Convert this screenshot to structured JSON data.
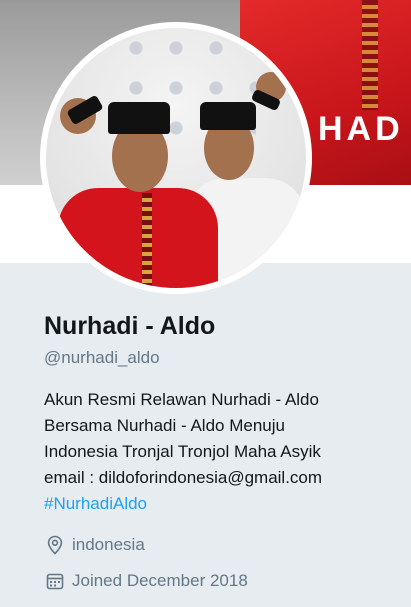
{
  "banner": {
    "text": "HAD"
  },
  "profile": {
    "display_name": "Nurhadi - Aldo",
    "handle": "@nurhadi_aldo",
    "bio": [
      "Akun Resmi Relawan Nurhadi - Aldo",
      "Bersama Nurhadi - Aldo Menuju",
      "Indonesia Tronjal Tronjol Maha Asyik",
      "email : dildoforindonesia@gmail.com"
    ],
    "hashtag": "#NurhadiAldo",
    "location": "indonesia",
    "joined": "Joined December 2018"
  },
  "icons": {
    "location": "location-pin-icon",
    "joined": "calendar-icon"
  },
  "colors": {
    "background": "#e6ecf0",
    "link": "#1da1f2",
    "secondary_text": "#657786",
    "banner_red": "#d3141c"
  }
}
